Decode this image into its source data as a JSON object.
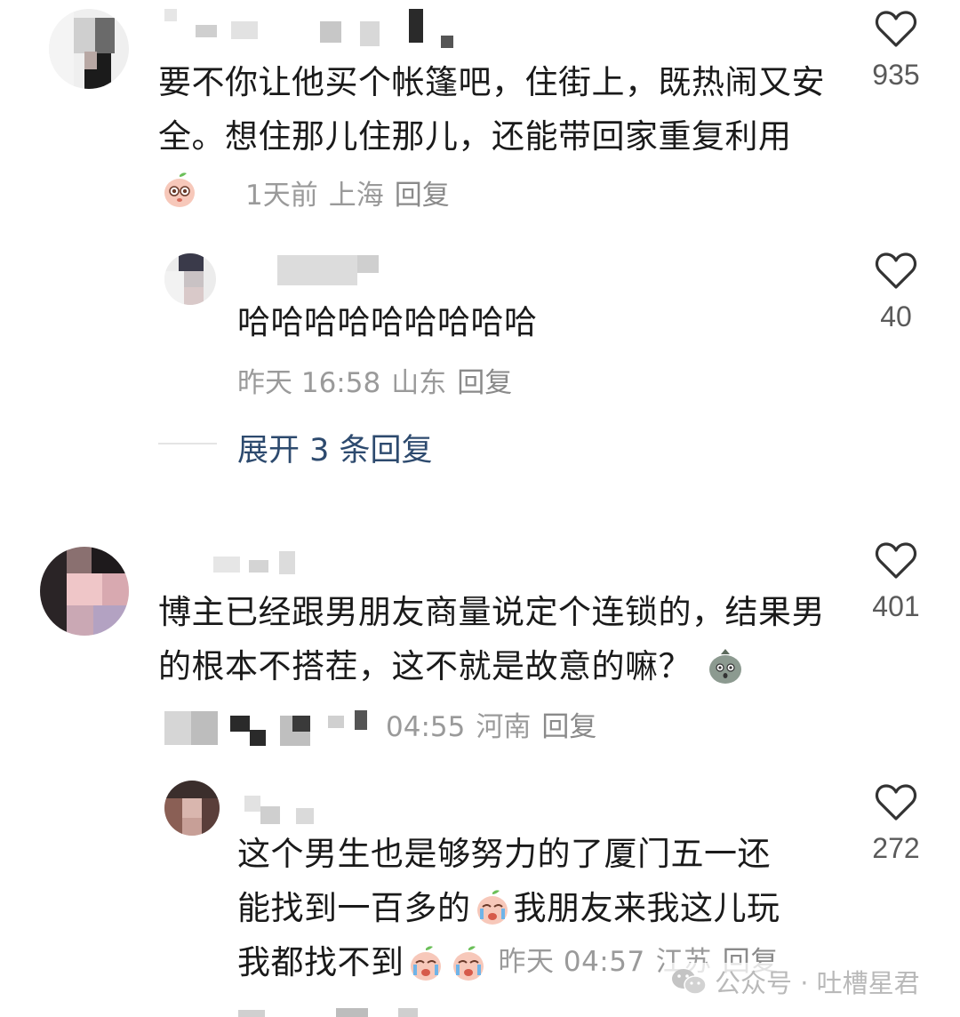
{
  "comments": [
    {
      "text": "要不你让他买个帐篷吧，住街上，既热闹又安全。想住那儿住那儿，还能带回家重复利用",
      "time": "1天前",
      "location": "上海",
      "reply_label": "回复",
      "likes": "935",
      "emoji": "peach-wide-eyes-emoji"
    },
    {
      "text": "哈哈哈哈哈哈哈哈哈",
      "time": "昨天 16:58",
      "location": "山东",
      "reply_label": "回复",
      "likes": "40",
      "is_reply": true
    },
    {
      "expand_label": "展开 3 条回复"
    },
    {
      "text": "博主已经跟男朋友商量说定个连锁的，结果男的根本不搭茬，这不就是故意的嘛？",
      "time": "04:55",
      "location": "河南",
      "reply_label": "回复",
      "likes": "401",
      "emoji": "bag-surprised-emoji"
    },
    {
      "text_line1": "这个男生也是够努力的了厦门五一还",
      "text_line2a": "能找到一百多的",
      "text_line2b": "我朋友来我这儿玩",
      "text_line3": "我都找不到",
      "time": "昨天 04:57",
      "location": "江苏",
      "reply_label": "回复",
      "likes": "272",
      "is_reply": true,
      "emoji": "peach-crying-emoji"
    }
  ],
  "watermark": {
    "icon": "wechat-icon",
    "text": "公众号 · 吐槽星君"
  },
  "colors": {
    "text": "#1a1a1a",
    "meta": "#9a9a9a",
    "expand": "#2d4a6e",
    "heart_stroke": "#333333"
  }
}
